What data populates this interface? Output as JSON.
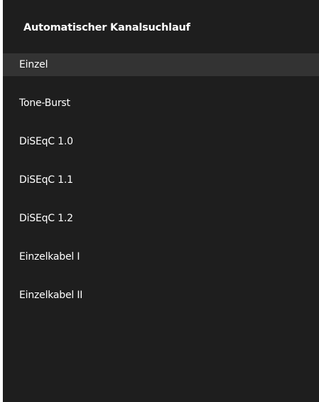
{
  "title": "Automatischer Kanalsuchlauf",
  "menu": {
    "selected_index": 0,
    "items": [
      {
        "label": "Einzel"
      },
      {
        "label": "Tone-Burst"
      },
      {
        "label": "DiSEqC 1.0"
      },
      {
        "label": "DiSEqC 1.1"
      },
      {
        "label": "DiSEqC 1.2"
      },
      {
        "label": "Einzelkabel I"
      },
      {
        "label": "Einzelkabel II"
      }
    ]
  },
  "colors": {
    "panel_background": "#1e1e1e",
    "selected_row_background": "#333333",
    "text": "#ffffff"
  }
}
